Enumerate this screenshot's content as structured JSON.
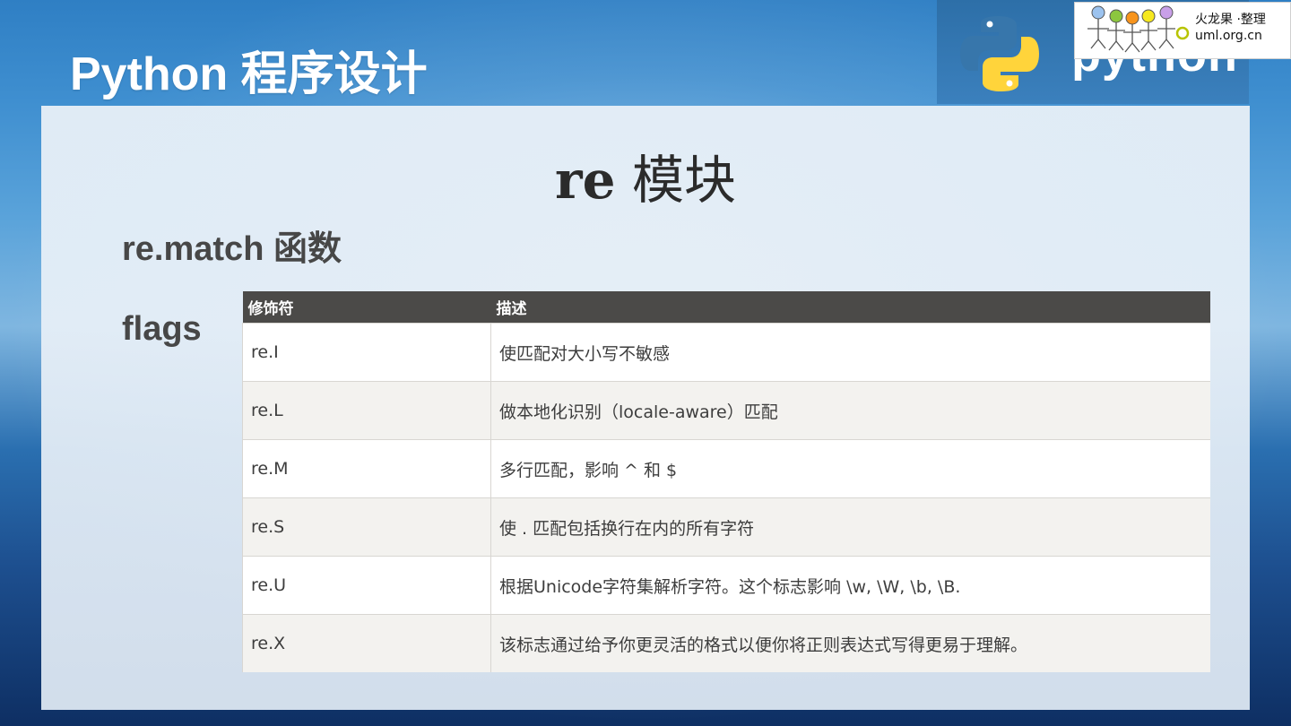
{
  "deck_title": "Python 程序设计",
  "python_banner": {
    "wordmark": "python"
  },
  "badge": {
    "name": "火龙果 ·整理",
    "url": "uml.org.cn"
  },
  "slide": {
    "title_keyword": "re",
    "title_rest": "模块",
    "subtitle": "re.match 函数",
    "flags_label": "flags"
  },
  "table": {
    "headers": [
      "修饰符",
      "描述"
    ],
    "rows": [
      [
        "re.I",
        "使匹配对大小写不敏感"
      ],
      [
        "re.L",
        "做本地化识别（locale-aware）匹配"
      ],
      [
        "re.M",
        "多行匹配，影响 ^ 和 $"
      ],
      [
        "re.S",
        "使 . 匹配包括换行在内的所有字符"
      ],
      [
        "re.U",
        "根据Unicode字符集解析字符。这个标志影响 \\w, \\W, \\b, \\B."
      ],
      [
        "re.X",
        "该标志通过给予你更灵活的格式以便你将正则表达式写得更易于理解。"
      ]
    ]
  },
  "colors": {
    "python_blue": "#3776ab",
    "python_yellow": "#ffd43b",
    "header_bg": "#4b4a48"
  }
}
